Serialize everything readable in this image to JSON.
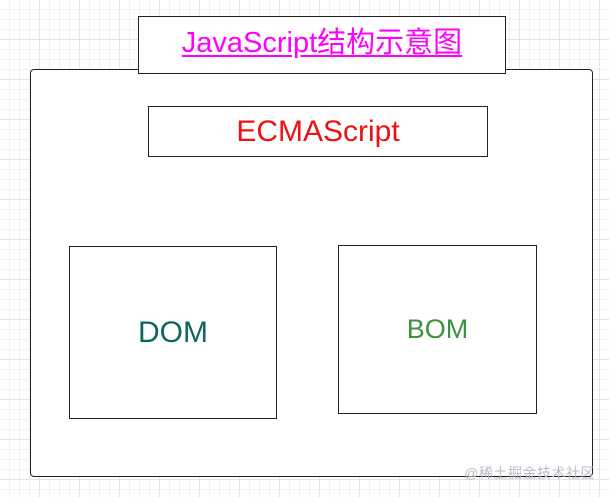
{
  "title": {
    "text": "JavaScript结构示意图",
    "color": "#ff00ff"
  },
  "ecmascript": {
    "label": "ECMAScript",
    "color": "#ee1111"
  },
  "dom": {
    "label": "DOM",
    "color": "#0d6660"
  },
  "bom": {
    "label": "BOM",
    "color": "#3f9142"
  },
  "watermark": {
    "text": "@稀土掘金技术社区"
  }
}
